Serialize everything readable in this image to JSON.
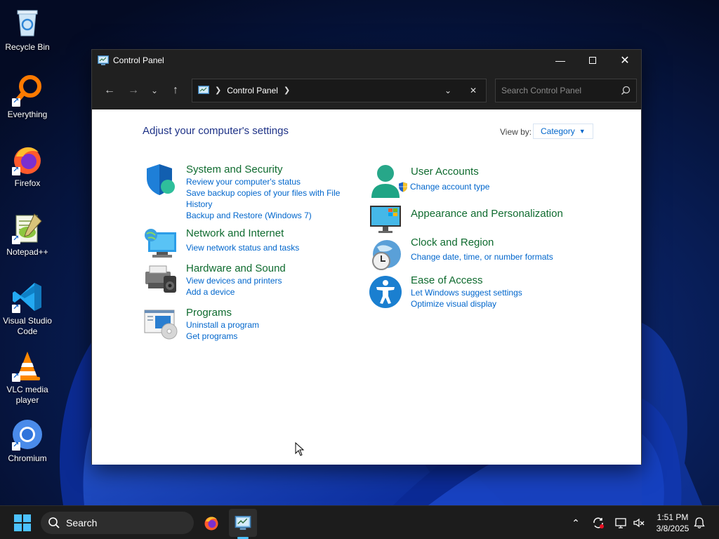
{
  "desktop": {
    "icons": [
      {
        "label": "Recycle Bin",
        "icon": "recycle-bin-icon"
      },
      {
        "label": "Everything",
        "icon": "everything-search-icon"
      },
      {
        "label": "Firefox",
        "icon": "firefox-icon"
      },
      {
        "label": "Notepad++",
        "icon": "notepad-plus-plus-icon"
      },
      {
        "label": "Visual Studio Code",
        "icon": "vscode-icon"
      },
      {
        "label": "VLC media player",
        "icon": "vlc-icon"
      },
      {
        "label": "Chromium",
        "icon": "chromium-icon"
      }
    ]
  },
  "window": {
    "title": "Control Panel",
    "address": {
      "crumb": "Control Panel"
    },
    "search": {
      "placeholder": "Search Control Panel"
    },
    "heading": "Adjust your computer's settings",
    "view_by": {
      "label": "View by:",
      "value": "Category"
    },
    "categories": [
      {
        "title": "System and Security",
        "icon": "shield-icon",
        "links": [
          "Review your computer's status",
          "Save backup copies of your files with File History",
          "Backup and Restore (Windows 7)"
        ]
      },
      {
        "title": "Network and Internet",
        "icon": "network-globe-icon",
        "links": [
          "View network status and tasks"
        ]
      },
      {
        "title": "Hardware and Sound",
        "icon": "printer-speaker-icon",
        "links": [
          "View devices and printers",
          "Add a device"
        ]
      },
      {
        "title": "Programs",
        "icon": "programs-disc-icon",
        "links": [
          "Uninstall a program",
          "Get programs"
        ]
      },
      {
        "title": "User Accounts",
        "icon": "user-accounts-icon",
        "links": [
          "Change account type"
        ]
      },
      {
        "title": "Appearance and Personalization",
        "icon": "monitor-personalization-icon",
        "links": []
      },
      {
        "title": "Clock and Region",
        "icon": "clock-globe-icon",
        "links": [
          "Change date, time, or number formats"
        ]
      },
      {
        "title": "Ease of Access",
        "icon": "ease-of-access-icon",
        "links": [
          "Let Windows suggest settings",
          "Optimize visual display"
        ]
      }
    ]
  },
  "taskbar": {
    "search_label": "Search",
    "time": "1:51 PM",
    "date": "3/8/2025"
  },
  "colors": {
    "category_title": "#0f6b2f",
    "link": "#0066cc",
    "heading": "#1e3287",
    "accent": "#4cc2ff"
  }
}
